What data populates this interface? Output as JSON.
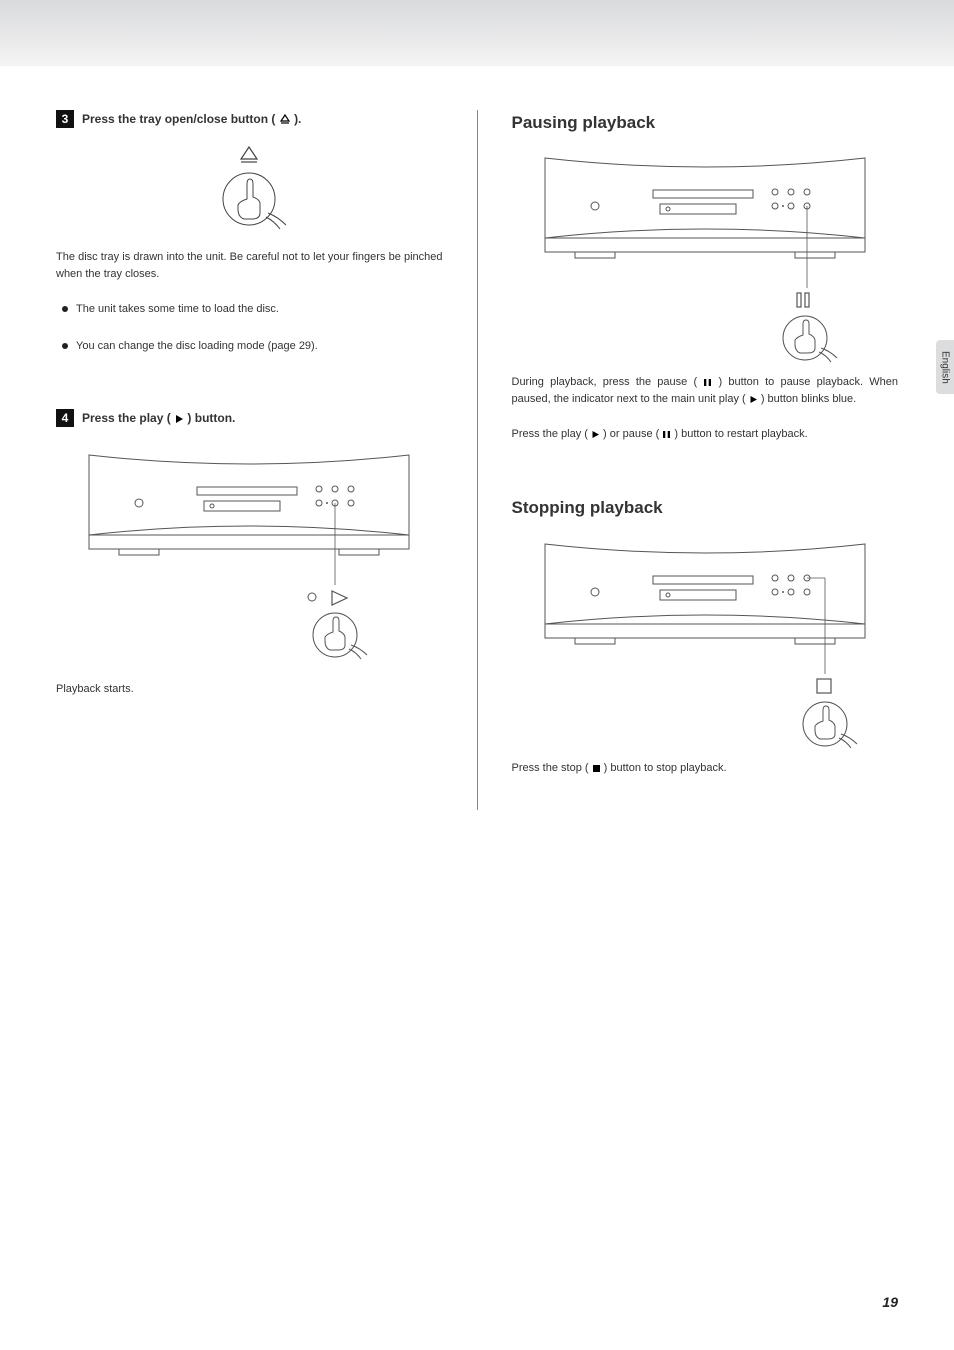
{
  "sideTab": "English",
  "pageNumber": "19",
  "left": {
    "step3": {
      "num": "3",
      "title_pre": "Press the tray open/close button (",
      "title_post": ")."
    },
    "step3_desc": "The disc tray is drawn into the unit. Be careful not to let your fingers be pinched when the tray closes.",
    "bullets": [
      "The unit takes some time to load the disc.",
      "You can change the disc loading mode (page 29)."
    ],
    "step4": {
      "num": "4",
      "title_pre": "Press the play (",
      "title_post": ") button."
    },
    "step4_desc": "Playback starts."
  },
  "right": {
    "pausing": {
      "heading": "Pausing playback",
      "para1_a": "During playback, press the pause (",
      "para1_b": ") button to pause playback. When paused, the indicator next to the main unit play (",
      "para1_c": ") button blinks blue.",
      "para2_a": "Press the play (",
      "para2_b": ") or pause (",
      "para2_c": ") button to restart playback."
    },
    "stopping": {
      "heading": "Stopping playback",
      "para_a": "Press the stop (",
      "para_b": ") button to stop playback."
    }
  }
}
